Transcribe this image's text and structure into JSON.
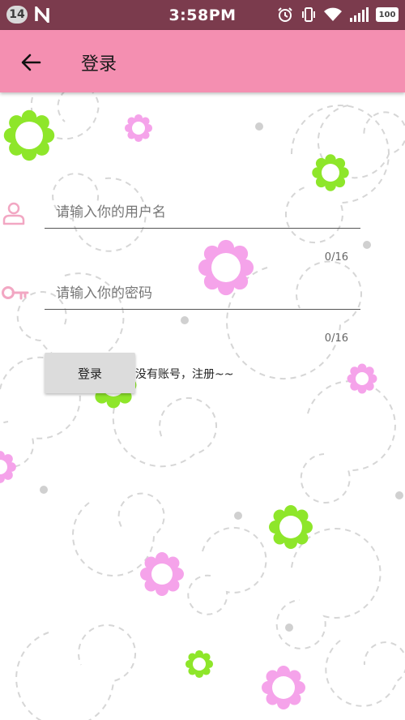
{
  "status_bar": {
    "notification_count": "14",
    "time": "3:58PM",
    "battery": "100",
    "icons": [
      "alarm-icon",
      "vibrate-icon",
      "wifi-icon",
      "signal-icon",
      "battery-icon"
    ]
  },
  "app_bar": {
    "title": "登录",
    "back_icon": "arrow-left-icon"
  },
  "form": {
    "username": {
      "placeholder": "请输入你的用户名",
      "value": "",
      "counter": "0/16",
      "icon": "user-icon"
    },
    "password": {
      "placeholder": "请输入你的密码",
      "value": "",
      "counter": "0/16",
      "icon": "key-icon"
    },
    "login_label": "登录",
    "register_text": "没有账号，注册~~"
  },
  "colors": {
    "status_bar": "#7b3b4d",
    "app_bar": "#f48fb1",
    "icon_pink": "#f2a7c3",
    "flower_green": "#8ee62a",
    "flower_pink": "#f5a3ea"
  }
}
